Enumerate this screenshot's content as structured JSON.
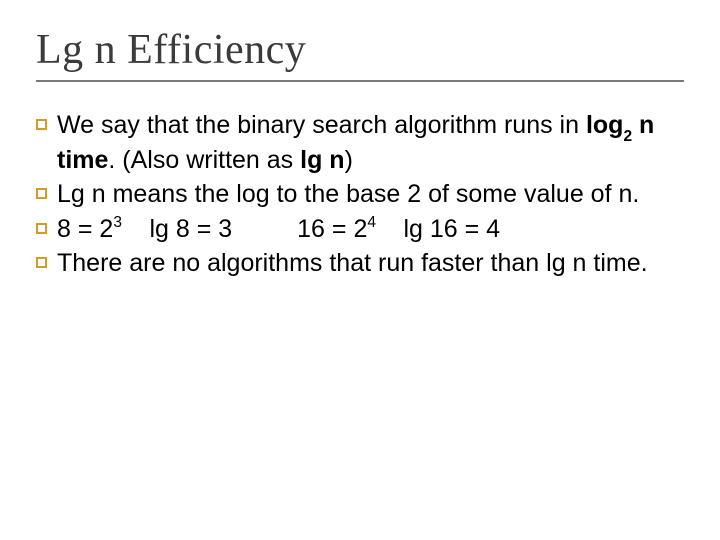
{
  "title": "Lg n  Efficiency",
  "bullets": {
    "b1": {
      "t1": "We say that the binary search algorithm runs in ",
      "bold1a": "log",
      "bold1sub": "2",
      "bold1b": " n  time",
      "t2": ".  (Also written as ",
      "bold2": "lg n",
      "t3": ")"
    },
    "b2": {
      "t1": "Lg n means the log to the base 2 of some value of n."
    },
    "b3": {
      "p1a": "8 = 2",
      "p1sup": "3",
      "p2": "lg 8 = 3",
      "p3a": "16 = 2",
      "p3sup": "4",
      "p4": "lg 16 = 4"
    },
    "b4": {
      "t1": "There are no algorithms that run faster than lg n time."
    }
  }
}
